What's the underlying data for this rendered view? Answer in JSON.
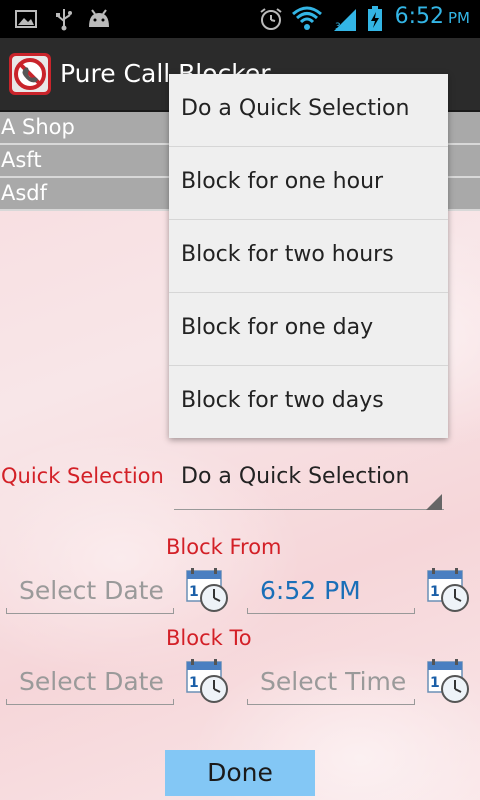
{
  "status_bar": {
    "time": "6:52",
    "ampm": "PM",
    "icons": [
      "image-icon",
      "usb-icon",
      "android-icon",
      "alarm-icon",
      "wifi-icon",
      "signal-icon",
      "battery-charging-icon"
    ],
    "accent_color": "#33b5e5"
  },
  "action_bar": {
    "title": "Pure Call Blocker",
    "icon": "app-call-block-icon"
  },
  "list": {
    "items": [
      "A Shop",
      "Asft",
      "Asdf"
    ]
  },
  "form": {
    "quick_selection_label": "Quick Selection",
    "quick_selection_value": "Do a Quick Selection",
    "block_from_label": "Block From",
    "from_date_placeholder": "Select Date",
    "from_time_value": "6:52 PM",
    "block_to_label": "Block To",
    "to_date_placeholder": "Select Date",
    "to_time_placeholder": "Select Time",
    "done_label": "Done",
    "label_color": "#d32027",
    "done_color": "#83c7f5"
  },
  "dropdown": {
    "options": [
      "Do a Quick Selection",
      "Block for one hour",
      "Block for two hours",
      "Block for one day",
      "Block for two days"
    ]
  }
}
